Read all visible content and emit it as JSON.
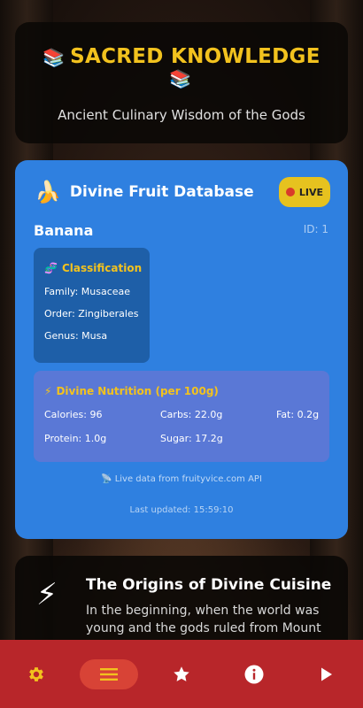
{
  "header": {
    "icon": "book-icon",
    "title": "SACRED KNOWLEDGE",
    "subtitle": "Ancient Culinary Wisdom of the Gods"
  },
  "fruit_card": {
    "icon": "banana-icon",
    "title": "Divine Fruit Database",
    "live_label": "LIVE",
    "fruit_name": "Banana",
    "fruit_id": "ID: 1",
    "classification": {
      "icon": "dna-icon",
      "title": "Classification",
      "family": "Family: Musaceae",
      "order": "Order: Zingiberales",
      "genus": "Genus: Musa"
    },
    "nutrition": {
      "icon": "lightning-icon",
      "title": "Divine Nutrition (per 100g)",
      "calories": "Calories: 96",
      "carbs": "Carbs: 22.0g",
      "fat": "Fat: 0.2g",
      "protein": "Protein: 1.0g",
      "sugar": "Sugar: 17.2g"
    },
    "api_note": "📡 Live data from fruityvice.com API",
    "last_updated": "Last updated: 15:59:10"
  },
  "origins": {
    "icon": "lightning-icon",
    "title": "The Origins of Divine Cuisine",
    "text": "In the beginning, when the world was young and the gods ruled from Mount"
  },
  "bottom_nav": {
    "items": [
      "settings",
      "menu",
      "favorites",
      "info",
      "play"
    ],
    "active": "menu"
  },
  "colors": {
    "accent_gold": "#f2c21e",
    "card_blue": "#2f80e0",
    "nav_red": "#b8262a"
  }
}
